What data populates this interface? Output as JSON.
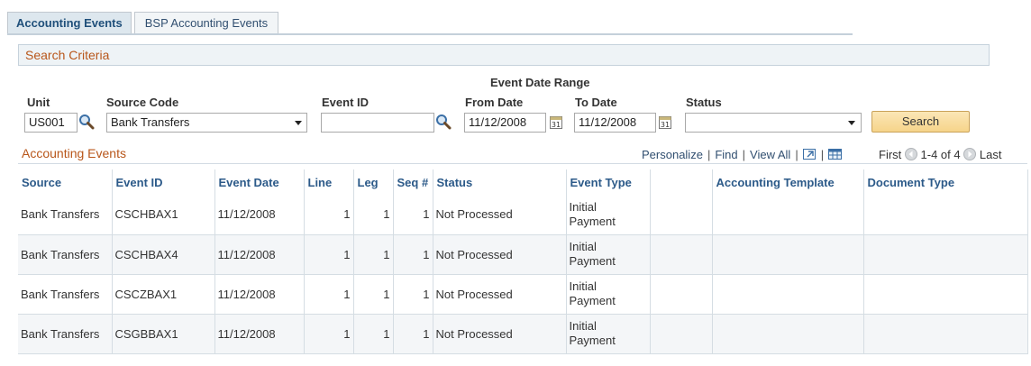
{
  "tabs": [
    {
      "label": "Accounting Events",
      "active": true
    },
    {
      "label": "BSP Accounting Events",
      "active": false
    }
  ],
  "search_criteria": {
    "header": "Search Criteria",
    "event_date_range_label": "Event Date Range",
    "unit": {
      "label": "Unit",
      "value": "US001"
    },
    "source_code": {
      "label": "Source Code",
      "value": "Bank Transfers"
    },
    "event_id": {
      "label": "Event ID",
      "value": ""
    },
    "from_date": {
      "label": "From Date",
      "value": "11/12/2008"
    },
    "to_date": {
      "label": "To Date",
      "value": "11/12/2008"
    },
    "status": {
      "label": "Status",
      "value": ""
    },
    "search_button": "Search"
  },
  "grid": {
    "title": "Accounting Events",
    "links": {
      "personalize": "Personalize",
      "find": "Find",
      "view_all": "View All"
    },
    "nav": {
      "first": "First",
      "range": "1-4 of 4",
      "last": "Last"
    },
    "columns": [
      "Source",
      "Event ID",
      "Event Date",
      "Line",
      "Leg",
      "Seq #",
      "Status",
      "Event Type",
      "",
      "Accounting Template",
      "Document Type"
    ],
    "rows": [
      {
        "source": "Bank Transfers",
        "event_id": "CSCHBAX1",
        "event_date": "11/12/2008",
        "line": "1",
        "leg": "1",
        "seq": "1",
        "status": "Not Processed",
        "event_type_1": "Initial",
        "event_type_2": "Payment",
        "blank": "",
        "accounting_template": "",
        "document_type": ""
      },
      {
        "source": "Bank Transfers",
        "event_id": "CSCHBAX4",
        "event_date": "11/12/2008",
        "line": "1",
        "leg": "1",
        "seq": "1",
        "status": "Not Processed",
        "event_type_1": "Initial",
        "event_type_2": "Payment",
        "blank": "",
        "accounting_template": "",
        "document_type": ""
      },
      {
        "source": "Bank Transfers",
        "event_id": "CSCZBAX1",
        "event_date": "11/12/2008",
        "line": "1",
        "leg": "1",
        "seq": "1",
        "status": "Not Processed",
        "event_type_1": "Initial",
        "event_type_2": "Payment",
        "blank": "",
        "accounting_template": "",
        "document_type": ""
      },
      {
        "source": "Bank Transfers",
        "event_id": "CSGBBAX1",
        "event_date": "11/12/2008",
        "line": "1",
        "leg": "1",
        "seq": "1",
        "status": "Not Processed",
        "event_type_1": "Initial",
        "event_type_2": "Payment",
        "blank": "",
        "accounting_template": "",
        "document_type": ""
      }
    ]
  },
  "icons": {
    "lookup": "magnifier-icon",
    "calendar": "calendar-icon",
    "zoom": "zoom-grid-icon",
    "download": "download-excel-icon",
    "prev": "previous-arrow-icon",
    "next": "next-arrow-icon"
  },
  "colors": {
    "section_title": "#b8561a",
    "link": "#314f70",
    "header_text": "#2c5a89",
    "search_button": "#f6d48a"
  }
}
